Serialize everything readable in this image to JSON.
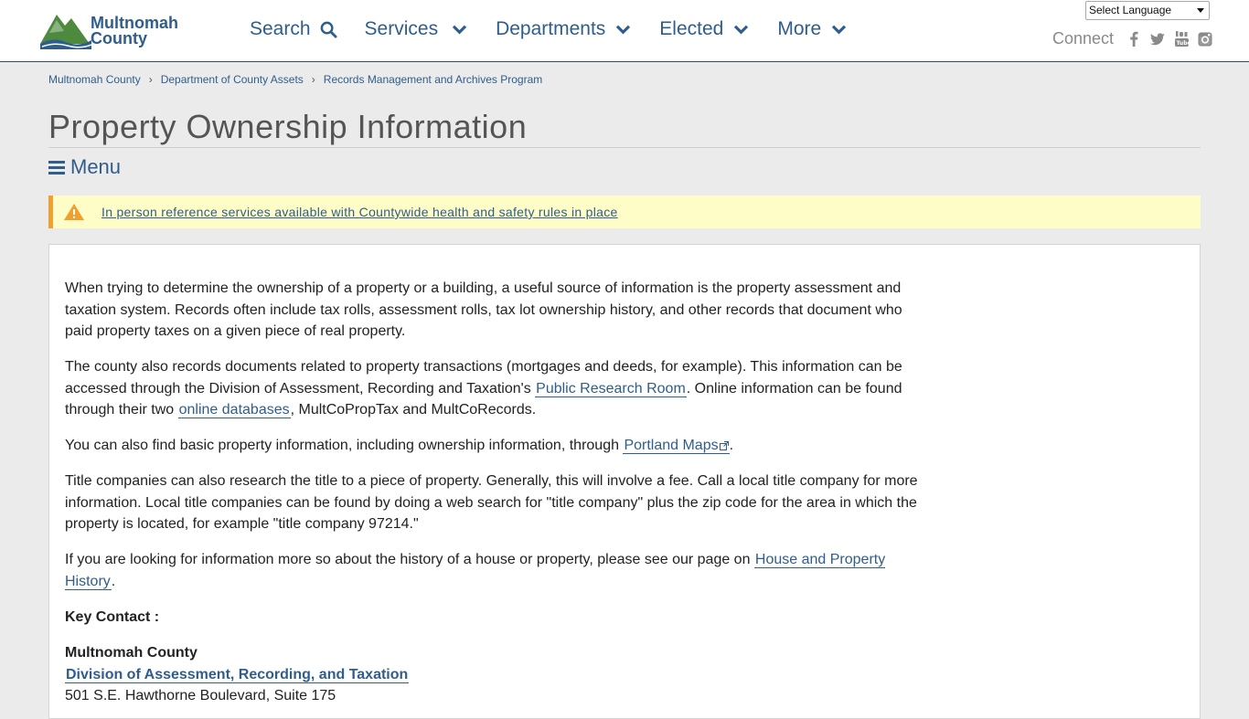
{
  "header": {
    "logo": {
      "line1": "Multnomah",
      "line2": "County"
    },
    "nav": [
      {
        "label": "Search",
        "icon": "search-icon"
      },
      {
        "label": "Services",
        "icon": "chevron-down-icon"
      },
      {
        "label": "Departments",
        "icon": "chevron-down-icon"
      },
      {
        "label": "Elected",
        "icon": "chevron-down-icon"
      },
      {
        "label": "More",
        "icon": "chevron-down-icon"
      }
    ],
    "language": {
      "selected": "Select Language"
    },
    "connect": {
      "label": "Connect",
      "icons": [
        "facebook-icon",
        "twitter-icon",
        "youtube-icon",
        "instagram-icon"
      ]
    }
  },
  "breadcrumb": [
    "Multnomah County",
    "Department of County Assets",
    "Records Management and Archives Program"
  ],
  "page": {
    "title": "Property Ownership Information",
    "menu_label": "Menu"
  },
  "alert": {
    "text": "In person reference services available with Countywide health and safety rules in place"
  },
  "content": {
    "p1": "When trying to determine the ownership of a property or a building, a useful source of information is the property assessment and taxation system. Records often include tax rolls, assessment rolls, tax lot ownership history, and other records that document who paid property taxes on a given piece of real property.",
    "p2_a": "The county also records documents related to property transactions (mortgages and deeds, for example). This information can be accessed through the Division of Assessment, Recording and Taxation's ",
    "p2_link1": "Public Research Room",
    "p2_b": ". Online information can be found through their two ",
    "p2_link2": "online databases",
    "p2_c": ", MultCoPropTax and MultCoRecords.",
    "p3_a": "You can also find basic property information, including ownership information, through ",
    "p3_link": "Portland Maps",
    "p3_b": ".",
    "p4": "Title companies can also research the title to a piece of property. Generally, this will involve a fee. Call a local title company for more information. Local title companies can be found by doing a web search for \"title company\" plus the zip code for the area in which the property is located, for example \"title company 97214.\"",
    "p5_a": "If you are looking for information more so about the history of a house or property, please see our page on ",
    "p5_link": "House and Property History",
    "p5_b": ".",
    "key_contact": "Key Contact :",
    "org": "Multnomah County",
    "dept_link": "Division of Assessment, Recording, and Taxation",
    "address": "501 S.E. Hawthorne Boulevard, Suite 175"
  },
  "colors": {
    "brand_blue": "#2f5d8e",
    "alert_bg": "#fefdc8",
    "alert_accent": "#f0a030",
    "logo_green": "#4e8a3e"
  }
}
